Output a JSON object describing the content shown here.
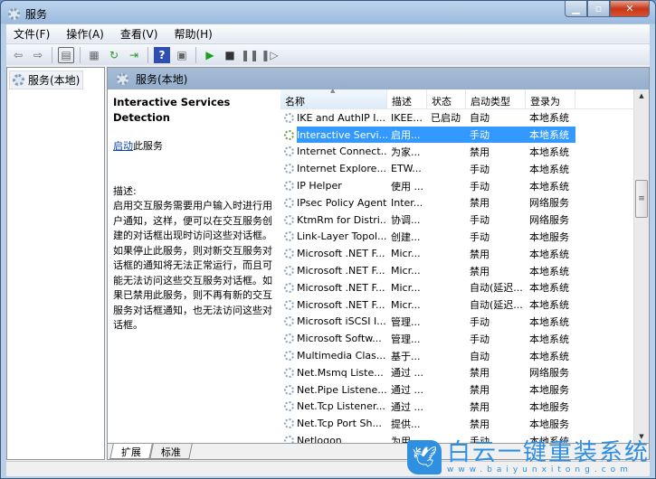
{
  "window": {
    "title": "服务"
  },
  "menu": [
    "文件(F)",
    "操作(A)",
    "查看(V)",
    "帮助(H)"
  ],
  "toolbar": [
    "back-icon",
    "forward-icon",
    "console-tree-icon",
    "properties-icon",
    "refresh-icon",
    "export-icon",
    "help-icon",
    "show-hide-icon",
    "play-icon",
    "stop-icon",
    "pause-icon",
    "resume-icon"
  ],
  "tree": {
    "item": "服务(本地)"
  },
  "pane": {
    "title": "服务(本地)"
  },
  "detail": {
    "name": "Interactive Services Detection",
    "start_link": "启动",
    "start_suffix": "此服务",
    "desc_label": "描述:",
    "desc": "启用交互服务需要用户输入时进行用户通知，这样，便可以在交互服务创建的对话框出现时访问这些对话框。如果停止此服务，则对新交互服务对话框的通知将无法正常运行，而且可能无法访问这些交互服务对话框。如果已禁用此服务，则不再有新的交互服务对话框通知，也无法访问这些对话框。"
  },
  "columns": [
    "名称",
    "描述",
    "状态",
    "启动类型",
    "登录为"
  ],
  "rows": [
    [
      "IKE and AuthIP I...",
      "IKEE...",
      "已启动",
      "自动",
      "本地系统"
    ],
    [
      "Interactive Servi...",
      "启用...",
      "",
      "手动",
      "本地系统"
    ],
    [
      "Internet Connect...",
      "为家...",
      "",
      "禁用",
      "本地系统"
    ],
    [
      "Internet Explore...",
      "ETW...",
      "",
      "手动",
      "本地系统"
    ],
    [
      "IP Helper",
      "使用 ...",
      "",
      "手动",
      "本地系统"
    ],
    [
      "IPsec Policy Agent",
      "Inter...",
      "",
      "禁用",
      "网络服务"
    ],
    [
      "KtmRm for Distri...",
      "协调...",
      "",
      "手动",
      "网络服务"
    ],
    [
      "Link-Layer Topol...",
      "创建...",
      "",
      "手动",
      "本地服务"
    ],
    [
      "Microsoft .NET F...",
      "Micr...",
      "",
      "禁用",
      "本地系统"
    ],
    [
      "Microsoft .NET F...",
      "Micr...",
      "",
      "禁用",
      "本地系统"
    ],
    [
      "Microsoft .NET F...",
      "Micr...",
      "",
      "自动(延迟...",
      "本地系统"
    ],
    [
      "Microsoft .NET F...",
      "Micr...",
      "",
      "自动(延迟...",
      "本地系统"
    ],
    [
      "Microsoft iSCSI I...",
      "管理...",
      "",
      "手动",
      "本地系统"
    ],
    [
      "Microsoft Softw...",
      "管理...",
      "",
      "手动",
      "本地系统"
    ],
    [
      "Multimedia Clas...",
      "基于...",
      "",
      "自动",
      "本地系统"
    ],
    [
      "Net.Msmq Liste...",
      "通过 ...",
      "",
      "禁用",
      "网络服务"
    ],
    [
      "Net.Pipe Listene...",
      "通过 ...",
      "",
      "禁用",
      "本地服务"
    ],
    [
      "Net.Tcp Listener...",
      "通过 ...",
      "",
      "禁用",
      "本地服务"
    ],
    [
      "Net.Tcp Port Sh...",
      "提供...",
      "",
      "禁用",
      "本地服务"
    ],
    [
      "Netlogon",
      "为用...",
      "",
      "手动",
      "本地系统"
    ]
  ],
  "selected_row": 1,
  "tabs": [
    "扩展",
    "标准"
  ],
  "watermark": {
    "title": "白云一键重装系统",
    "url": "www.baiyunxitong.com"
  }
}
